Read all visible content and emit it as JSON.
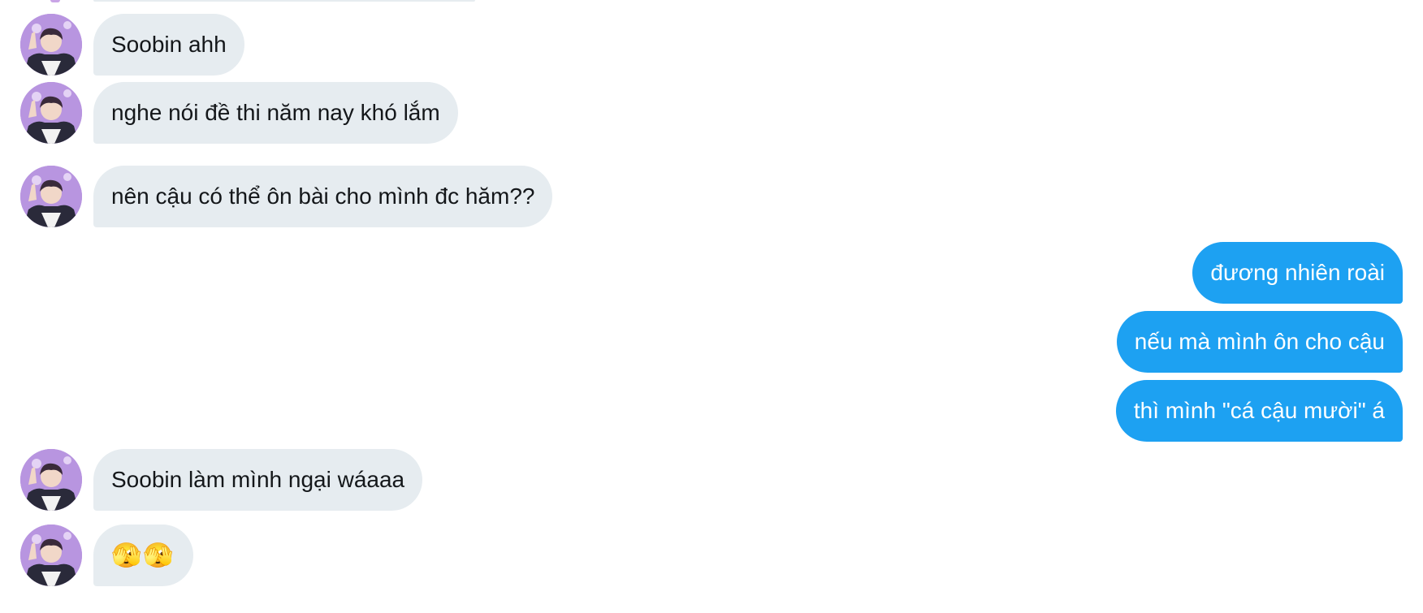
{
  "messages": [
    {
      "sender": "other",
      "text": "Soobin ahh"
    },
    {
      "sender": "other",
      "text": "nghe nói đề thi năm nay khó lắm"
    },
    {
      "sender": "other",
      "text": "nên cậu có thể ôn bài cho mình đc hăm??"
    },
    {
      "sender": "me",
      "text": "đương nhiên roài"
    },
    {
      "sender": "me",
      "text": "nếu mà mình ôn cho cậu"
    },
    {
      "sender": "me",
      "text": "thì mình \"cá cậu mười\" á"
    },
    {
      "sender": "other",
      "text": "Soobin làm mình ngại wáaaa"
    },
    {
      "sender": "other",
      "text": "🫣🫣"
    }
  ],
  "colors": {
    "incoming_bubble": "#e6ecf0",
    "outgoing_bubble": "#1da1f2",
    "incoming_text": "#14171a",
    "outgoing_text": "#ffffff",
    "avatar_background": "#b895e0"
  },
  "icons": {
    "avatar": "contact-avatar-photo"
  }
}
